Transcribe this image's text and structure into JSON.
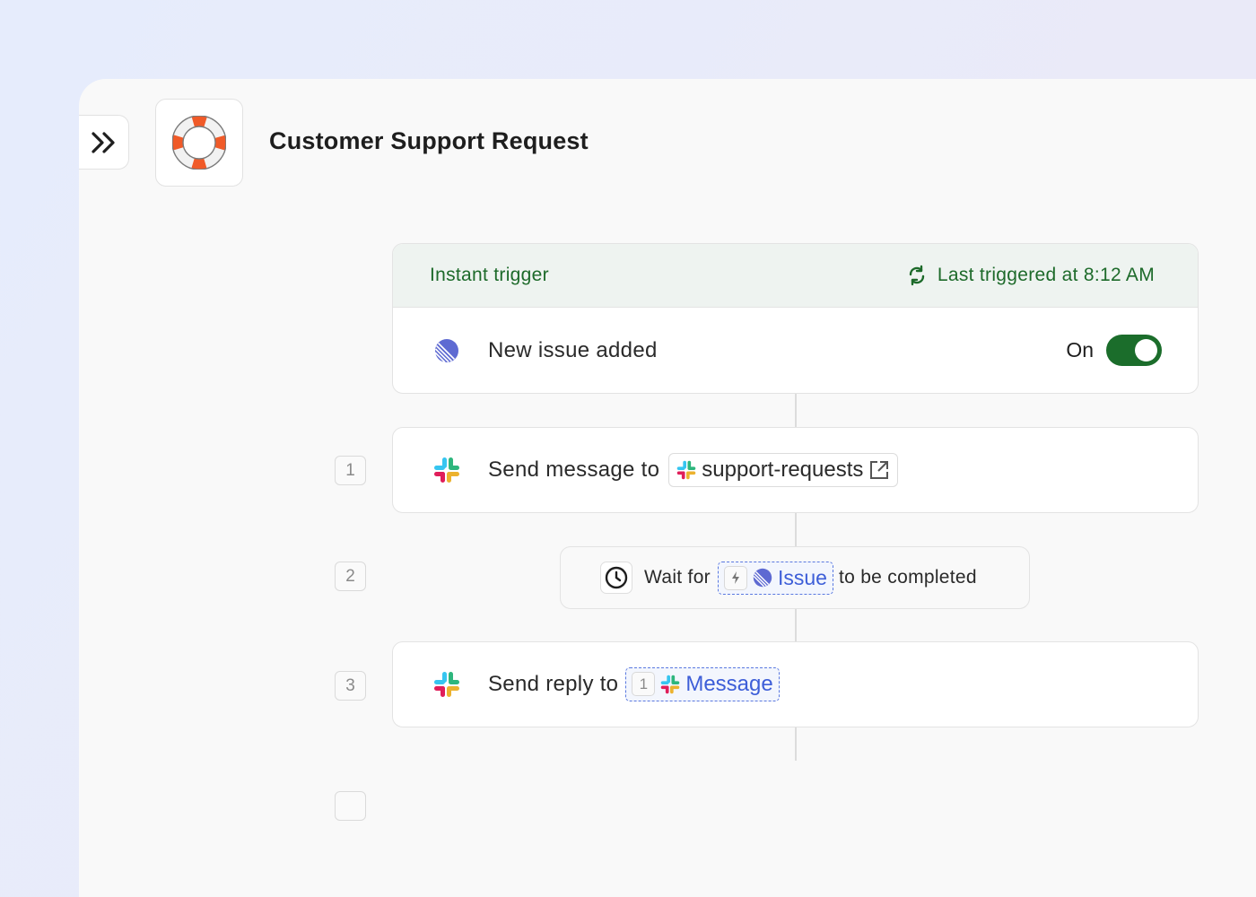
{
  "workflow": {
    "title": "Customer Support Request",
    "icon": "lifebuoy-icon"
  },
  "trigger": {
    "label": "Instant trigger",
    "last_triggered": "Last triggered at 8:12 AM",
    "event": "New issue added",
    "event_icon": "linear-app-icon",
    "toggle_label": "On",
    "toggle_state": "on",
    "accent_color": "#1d6a2a"
  },
  "steps": [
    {
      "number": "1",
      "action_text": "Send message to",
      "app_icon": "slack-icon",
      "channel": "support-requests",
      "link_icon": "external-link-icon"
    },
    {
      "number": "2",
      "prefix": "Wait for",
      "trigger_ref_icon": "bolt-icon",
      "ref_label": "Issue",
      "suffix": "to be completed",
      "icon": "clock-icon"
    },
    {
      "number": "3",
      "action_text": "Send reply to",
      "app_icon": "slack-icon",
      "ref_step": "1",
      "ref_label": "Message"
    }
  ],
  "colors": {
    "variable_blue": "#3d5ed8",
    "toggle_green": "#1b6d2b"
  }
}
